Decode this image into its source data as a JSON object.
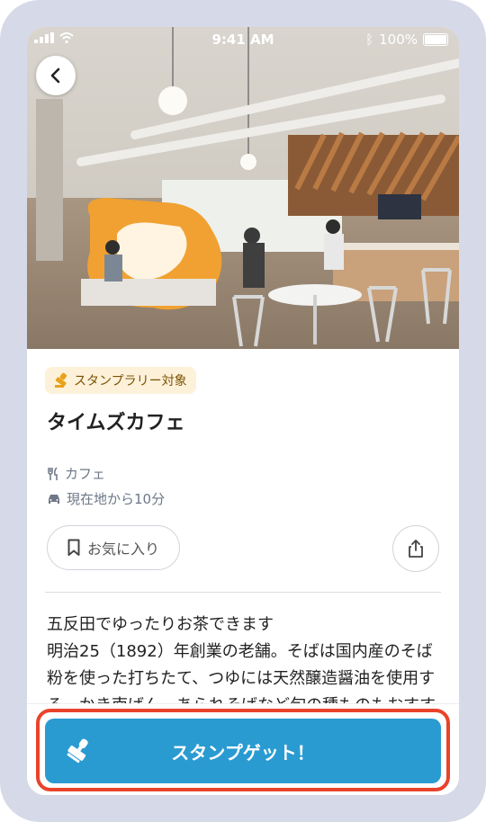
{
  "status_bar": {
    "time": "9:41 AM",
    "battery": "100%"
  },
  "badge": {
    "label": "スタンプラリー対象"
  },
  "place": {
    "name": "タイムズカフェ",
    "category": "カフェ",
    "distance": "現在地から10分"
  },
  "actions": {
    "favorite_label": "お気に入り"
  },
  "description": {
    "heading": "五反田でゆったりお茶できます",
    "body": "明治25（1892）年創業の老舗。そばは国内産のそば粉を使った打ちたて、つゆには天然醸造醤油を使用する。かき南ばん、あられそばなど旬の種ものもおすすめ。"
  },
  "cta": {
    "label": "スタンプゲット！"
  },
  "colors": {
    "accent": "#2a9bd1",
    "highlight": "#e8432b",
    "badge_bg": "#fdf1da",
    "frame": "#d6d9e8"
  }
}
